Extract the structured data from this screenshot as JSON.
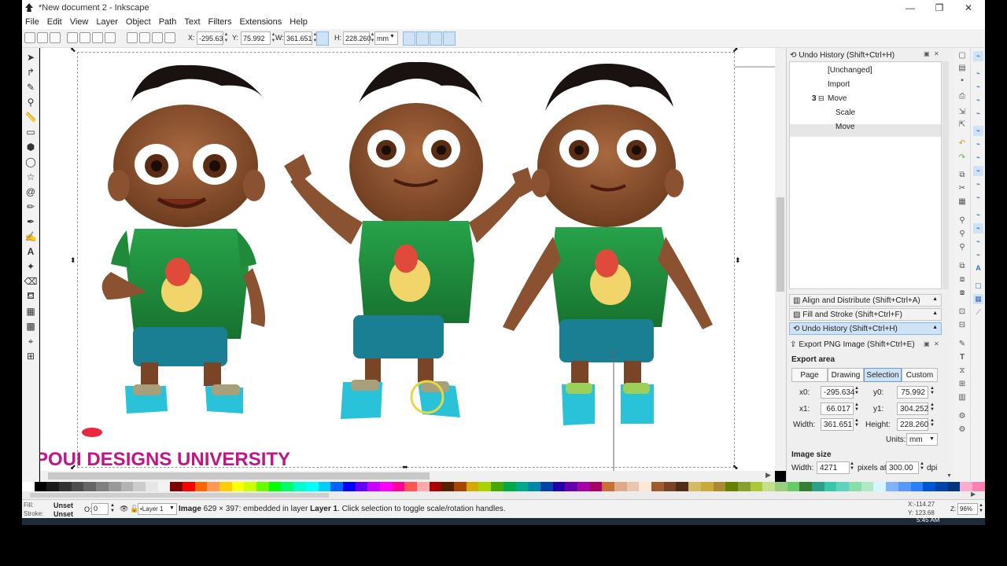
{
  "window": {
    "title": "*New document 2 - Inkscape",
    "minimize": "—",
    "maximize": "❐",
    "close": "✕"
  },
  "menu": [
    "File",
    "Edit",
    "View",
    "Layer",
    "Object",
    "Path",
    "Text",
    "Filters",
    "Extensions",
    "Help"
  ],
  "controls": {
    "x_label": "X:",
    "x_value": "-295.63",
    "y_label": "Y:",
    "y_value": "75.992",
    "w_label": "W:",
    "w_value": "361.651",
    "h_label": "H:",
    "h_value": "228.260",
    "unit": "mm"
  },
  "canvas": {
    "watermark": "POUI DESIGNS UNIVERSITY",
    "watermark_color": "#c0168a"
  },
  "undo_history": {
    "title": "Undo History (Shift+Ctrl+H)",
    "items": [
      "[Unchanged]",
      "Import",
      "Move",
      "Scale",
      "Move"
    ],
    "group_count": "3",
    "group_toggle": "⊟"
  },
  "dock_panels": {
    "align": "Align and Distribute (Shift+Ctrl+A)",
    "fill": "Fill and Stroke (Shift+Ctrl+F)",
    "undo": "Undo History (Shift+Ctrl+H)",
    "export": "Export PNG Image (Shift+Ctrl+E)"
  },
  "export": {
    "area_title": "Export area",
    "tabs": [
      "Page",
      "Drawing",
      "Selection",
      "Custom"
    ],
    "x0_label": "x0:",
    "x0": "-295.634",
    "y0_label": "y0:",
    "y0": "75.992",
    "x1_label": "x1:",
    "x1": "66.017",
    "y1_label": "y1:",
    "y1": "304.252",
    "width_label": "Width:",
    "width": "361.651",
    "height_label": "Height:",
    "height": "228.260",
    "units_label": "Units:",
    "units": "mm",
    "size_title": "Image size",
    "img_width_label": "Width:",
    "img_width": "4271",
    "pixels_at": "pixels at",
    "dpi_value": "300.00",
    "dpi": "dpi"
  },
  "status": {
    "fill_label": "Fill:",
    "fill_value": "Unset",
    "stroke_label": "Stroke:",
    "stroke_value": "Unset",
    "opacity_label": "O:",
    "opacity_value": "0",
    "layer": "•Layer 1",
    "message_strong": "Image",
    "message_rest": " 629 × 397: embedded in layer ",
    "message_layer": "Layer 1",
    "message_tail": ". Click selection to toggle scale/rotation handles.",
    "cursor_x": "X:-114.27",
    "cursor_y": "Y: 123.68",
    "zoom_label": "Z:",
    "zoom_value": "96%"
  },
  "taskbar": {
    "time": "5:45 AM"
  },
  "colors": {
    "accent": "#cfe3f7",
    "shirt": "#1f8a3a",
    "skin": "#8a5230",
    "shorts": "#1b7f94",
    "watermark": "#c0168a"
  }
}
